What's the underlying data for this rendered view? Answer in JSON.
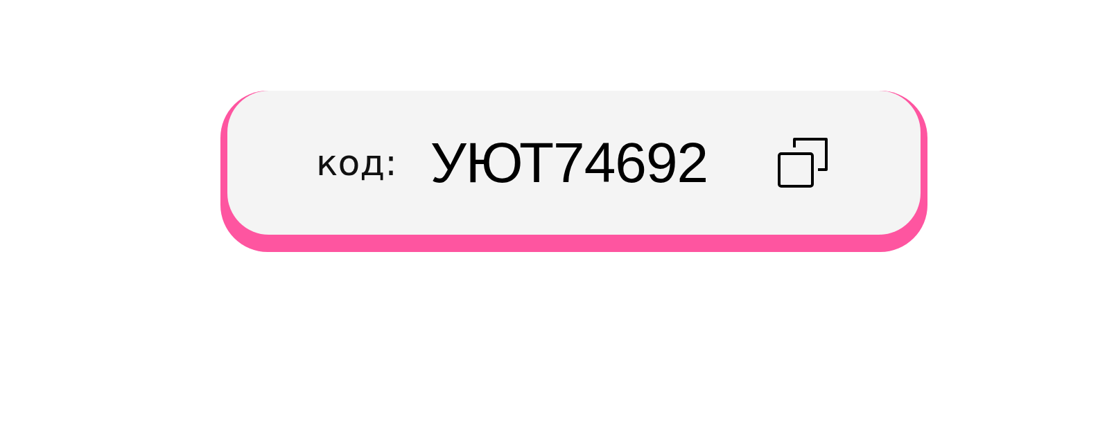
{
  "promo": {
    "label": "код:",
    "code": "УЮТ74692"
  }
}
